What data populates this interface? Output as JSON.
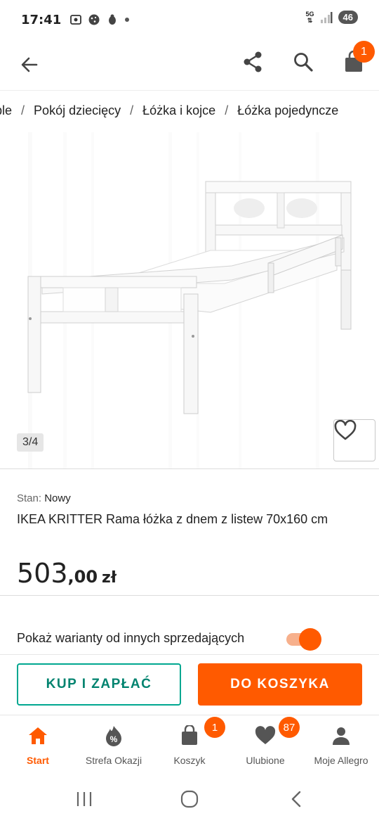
{
  "status_bar": {
    "time": "17:41",
    "network": "5G",
    "battery": "46"
  },
  "header": {
    "cart_count": "1"
  },
  "breadcrumb": [
    "eble",
    "Pokój dziecięcy",
    "Łóżka i kojce",
    "Łóżka pojedyncze"
  ],
  "gallery": {
    "counter": "3/4"
  },
  "product": {
    "condition_label": "Stan:",
    "condition_value": "Nowy",
    "title": "IKEA KRITTER Rama łóżka z dnem z listew 70x160 cm",
    "price_main": "503",
    "price_cents": ",00",
    "currency": "zł"
  },
  "variants": {
    "label": "Pokaż warianty od innych sprzedających",
    "enabled": true
  },
  "actions": {
    "buy_label": "KUP I ZAPŁAĆ",
    "cart_label": "DO KOSZYKA"
  },
  "bottom_nav": {
    "items": [
      {
        "label": "Start",
        "icon": "home-icon"
      },
      {
        "label": "Strefa Okazji",
        "icon": "deals-icon"
      },
      {
        "label": "Koszyk",
        "icon": "bag-icon",
        "badge": "1"
      },
      {
        "label": "Ulubione",
        "icon": "heart-icon",
        "badge": "87"
      },
      {
        "label": "Moje Allegro",
        "icon": "person-icon"
      }
    ]
  },
  "colors": {
    "accent": "#ff5a00",
    "teal": "#00a790"
  }
}
